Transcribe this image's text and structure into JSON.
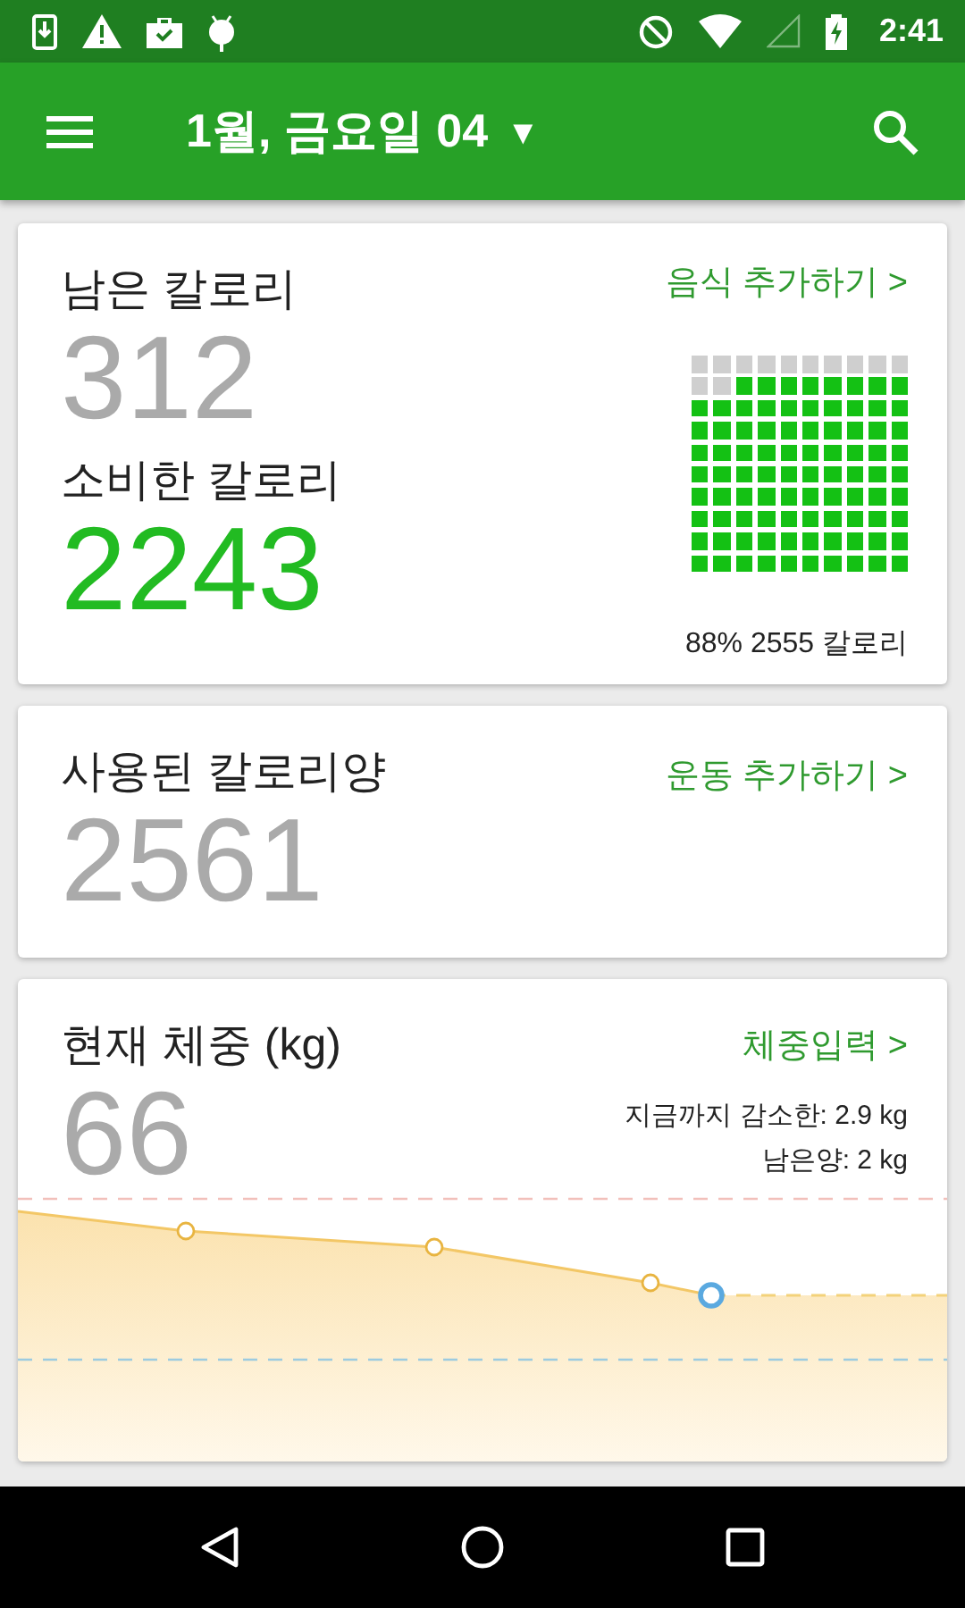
{
  "status_bar": {
    "time": "2:41"
  },
  "app_bar": {
    "title": "1월, 금요일 04",
    "dropdown": "▾"
  },
  "calories": {
    "remaining_label": "남은 칼로리",
    "remaining": "312",
    "consumed_label": "소비한 칼로리",
    "consumed": "2243",
    "add_link": "음식 추가하기 >",
    "summary": "88% 2555 칼로리"
  },
  "exercise": {
    "label": "사용된 칼로리양",
    "value": "2561",
    "add_link": "운동 추가하기 >"
  },
  "weight": {
    "label": "현재 체중 (kg)",
    "value": "66",
    "add_link": "체중입력 >",
    "lost": "지금까지 감소한: 2.9 kg",
    "remaining": "남은양: 2 kg"
  }
}
